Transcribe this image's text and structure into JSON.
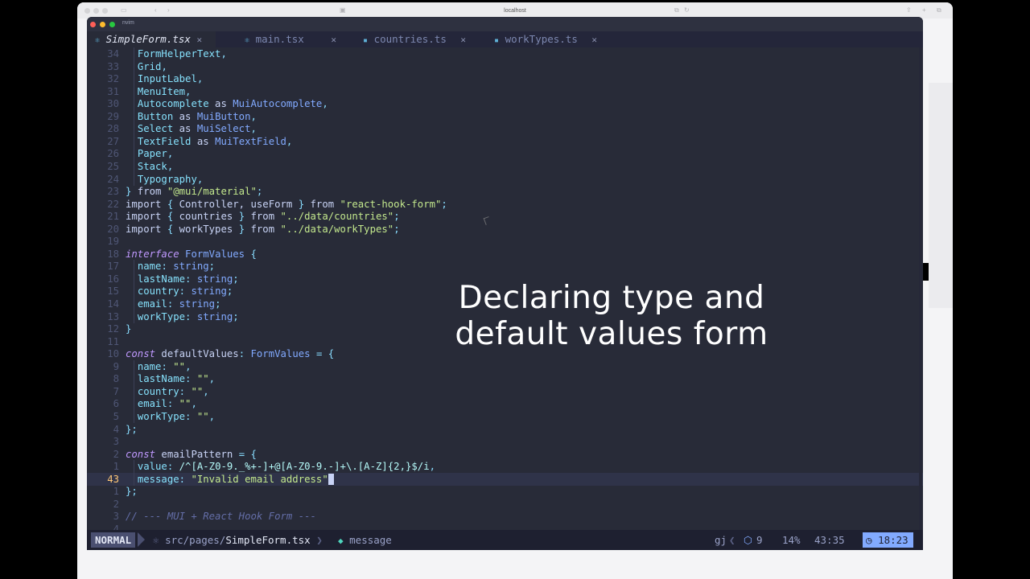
{
  "browser": {
    "url": "localhost"
  },
  "terminal": {
    "title": "nvim"
  },
  "tabs": [
    {
      "label": "SimpleForm.tsx",
      "active": true,
      "icon": "react-icon",
      "close": "✕"
    },
    {
      "label": "main.tsx",
      "active": false,
      "icon": "react-icon",
      "close": "✕"
    },
    {
      "label": "countries.ts",
      "active": false,
      "icon": "typescript-icon",
      "close": "✕"
    },
    {
      "label": "workTypes.ts",
      "active": false,
      "icon": "typescript-icon",
      "close": "✕"
    }
  ],
  "code_lines": [
    {
      "num": "34",
      "tokens": [
        [
          "",
          "  "
        ],
        [
          "pr",
          "FormHelperText"
        ],
        [
          "pu",
          ","
        ]
      ]
    },
    {
      "num": "33",
      "tokens": [
        [
          "",
          "  "
        ],
        [
          "pr",
          "Grid"
        ],
        [
          "pu",
          ","
        ]
      ]
    },
    {
      "num": "32",
      "tokens": [
        [
          "",
          "  "
        ],
        [
          "pr",
          "InputLabel"
        ],
        [
          "pu",
          ","
        ]
      ]
    },
    {
      "num": "31",
      "tokens": [
        [
          "",
          "  "
        ],
        [
          "pr",
          "MenuItem"
        ],
        [
          "pu",
          ","
        ]
      ]
    },
    {
      "num": "30",
      "tokens": [
        [
          "",
          "  "
        ],
        [
          "pr",
          "Autocomplete"
        ],
        [
          "",
          " as "
        ],
        [
          "ty",
          "MuiAutocomplete"
        ],
        [
          "pu",
          ","
        ]
      ]
    },
    {
      "num": "29",
      "tokens": [
        [
          "",
          "  "
        ],
        [
          "pr",
          "Button"
        ],
        [
          "",
          " as "
        ],
        [
          "ty",
          "MuiButton"
        ],
        [
          "pu",
          ","
        ]
      ]
    },
    {
      "num": "28",
      "tokens": [
        [
          "",
          "  "
        ],
        [
          "pr",
          "Select"
        ],
        [
          "",
          " as "
        ],
        [
          "ty",
          "MuiSelect"
        ],
        [
          "pu",
          ","
        ]
      ]
    },
    {
      "num": "27",
      "tokens": [
        [
          "",
          "  "
        ],
        [
          "pr",
          "TextField"
        ],
        [
          "",
          " as "
        ],
        [
          "ty",
          "MuiTextField"
        ],
        [
          "pu",
          ","
        ]
      ]
    },
    {
      "num": "26",
      "tokens": [
        [
          "",
          "  "
        ],
        [
          "pr",
          "Paper"
        ],
        [
          "pu",
          ","
        ]
      ]
    },
    {
      "num": "25",
      "tokens": [
        [
          "",
          "  "
        ],
        [
          "pr",
          "Stack"
        ],
        [
          "pu",
          ","
        ]
      ]
    },
    {
      "num": "24",
      "tokens": [
        [
          "",
          "  "
        ],
        [
          "pr",
          "Typography"
        ],
        [
          "pu",
          ","
        ]
      ]
    },
    {
      "num": "23",
      "tokens": [
        [
          "pu",
          "}"
        ],
        [
          "",
          " from "
        ],
        [
          "st",
          "\"@mui/material\""
        ],
        [
          "pu",
          ";"
        ]
      ]
    },
    {
      "num": "22",
      "tokens": [
        [
          "",
          "import "
        ],
        [
          "pu",
          "{ "
        ],
        [
          "",
          "Controller, useForm "
        ],
        [
          "pu",
          "}"
        ],
        [
          "",
          " from "
        ],
        [
          "st",
          "\"react-hook-form\""
        ],
        [
          "pu",
          ";"
        ]
      ]
    },
    {
      "num": "21",
      "tokens": [
        [
          "",
          "import "
        ],
        [
          "pu",
          "{ "
        ],
        [
          "",
          "countries "
        ],
        [
          "pu",
          "}"
        ],
        [
          "",
          " from "
        ],
        [
          "st",
          "\"../data/countries\""
        ],
        [
          "pu",
          ";"
        ]
      ]
    },
    {
      "num": "20",
      "tokens": [
        [
          "",
          "import "
        ],
        [
          "pu",
          "{ "
        ],
        [
          "",
          "workTypes "
        ],
        [
          "pu",
          "}"
        ],
        [
          "",
          " from "
        ],
        [
          "st",
          "\"../data/workTypes\""
        ],
        [
          "pu",
          ";"
        ]
      ]
    },
    {
      "num": "19",
      "tokens": []
    },
    {
      "num": "18",
      "tokens": [
        [
          "kw",
          "interface"
        ],
        [
          "",
          " "
        ],
        [
          "ty",
          "FormValues"
        ],
        [
          "pu",
          " {"
        ]
      ]
    },
    {
      "num": "17",
      "tokens": [
        [
          "",
          "  "
        ],
        [
          "pr",
          "name"
        ],
        [
          "pu",
          ": "
        ],
        [
          "ty",
          "string"
        ],
        [
          "pu",
          ";"
        ]
      ]
    },
    {
      "num": "16",
      "tokens": [
        [
          "",
          "  "
        ],
        [
          "pr",
          "lastName"
        ],
        [
          "pu",
          ": "
        ],
        [
          "ty",
          "string"
        ],
        [
          "pu",
          ";"
        ]
      ]
    },
    {
      "num": "15",
      "tokens": [
        [
          "",
          "  "
        ],
        [
          "pr",
          "country"
        ],
        [
          "pu",
          ": "
        ],
        [
          "ty",
          "string"
        ],
        [
          "pu",
          ";"
        ]
      ]
    },
    {
      "num": "14",
      "tokens": [
        [
          "",
          "  "
        ],
        [
          "pr",
          "email"
        ],
        [
          "pu",
          ": "
        ],
        [
          "ty",
          "string"
        ],
        [
          "pu",
          ";"
        ]
      ]
    },
    {
      "num": "13",
      "tokens": [
        [
          "",
          "  "
        ],
        [
          "pr",
          "workType"
        ],
        [
          "pu",
          ": "
        ],
        [
          "ty",
          "string"
        ],
        [
          "pu",
          ";"
        ]
      ]
    },
    {
      "num": "12",
      "tokens": [
        [
          "pu",
          "}"
        ]
      ]
    },
    {
      "num": "11",
      "tokens": []
    },
    {
      "num": "10",
      "tokens": [
        [
          "kw",
          "const"
        ],
        [
          "",
          " defaultValues"
        ],
        [
          "pu",
          ": "
        ],
        [
          "ty",
          "FormValues"
        ],
        [
          "pu",
          " = {"
        ]
      ]
    },
    {
      "num": "9",
      "tokens": [
        [
          "",
          "  "
        ],
        [
          "pr",
          "name"
        ],
        [
          "pu",
          ": "
        ],
        [
          "st",
          "\"\""
        ],
        [
          "pu",
          ","
        ]
      ]
    },
    {
      "num": "8",
      "tokens": [
        [
          "",
          "  "
        ],
        [
          "pr",
          "lastName"
        ],
        [
          "pu",
          ": "
        ],
        [
          "st",
          "\"\""
        ],
        [
          "pu",
          ","
        ]
      ]
    },
    {
      "num": "7",
      "tokens": [
        [
          "",
          "  "
        ],
        [
          "pr",
          "country"
        ],
        [
          "pu",
          ": "
        ],
        [
          "st",
          "\"\""
        ],
        [
          "pu",
          ","
        ]
      ]
    },
    {
      "num": "6",
      "tokens": [
        [
          "",
          "  "
        ],
        [
          "pr",
          "email"
        ],
        [
          "pu",
          ": "
        ],
        [
          "st",
          "\"\""
        ],
        [
          "pu",
          ","
        ]
      ]
    },
    {
      "num": "5",
      "tokens": [
        [
          "",
          "  "
        ],
        [
          "pr",
          "workType"
        ],
        [
          "pu",
          ": "
        ],
        [
          "st",
          "\"\""
        ],
        [
          "pu",
          ","
        ]
      ]
    },
    {
      "num": "4",
      "tokens": [
        [
          "pu",
          "};"
        ]
      ]
    },
    {
      "num": "3",
      "tokens": []
    },
    {
      "num": "2",
      "tokens": [
        [
          "kw",
          "const"
        ],
        [
          "",
          " emailPattern "
        ],
        [
          "pu",
          "= {"
        ]
      ]
    },
    {
      "num": "1",
      "tokens": [
        [
          "",
          "  "
        ],
        [
          "pr",
          "value"
        ],
        [
          "pu",
          ": "
        ],
        [
          "rx",
          "/^[A-Z0-9._%+-]+@[A-Z0-9.-]+\\.[A-Z]{2,}$/i"
        ],
        [
          "pu",
          ","
        ]
      ]
    },
    {
      "num": "43",
      "current": true,
      "tokens": [
        [
          "",
          "  "
        ],
        [
          "pr",
          "message"
        ],
        [
          "pu",
          ": "
        ],
        [
          "st",
          "\"Invalid email address\""
        ]
      ]
    },
    {
      "num": "1",
      "tokens": [
        [
          "pu",
          "};"
        ]
      ]
    },
    {
      "num": "2",
      "tokens": []
    },
    {
      "num": "3",
      "tokens": [
        [
          "cm",
          "// --- MUI + React Hook Form ---"
        ]
      ]
    },
    {
      "num": "4",
      "tokens": []
    }
  ],
  "statusline": {
    "mode": "NORMAL",
    "path_prefix": "src/pages/",
    "file": "SimpleForm.tsx",
    "symbol": "message",
    "branch_hint": "gj",
    "lsp_count": "9",
    "percent": "14%",
    "position": "43:35",
    "clock": "18:23"
  },
  "overlay": {
    "line1": "Declaring type and",
    "line2": "default values form"
  },
  "colors": {
    "editor_bg": "#282b38",
    "statusline_bg": "#1e2030",
    "accent_blue": "#82aaff",
    "keyword": "#c099ff",
    "string": "#c3e88d",
    "property": "#86e1fc"
  }
}
